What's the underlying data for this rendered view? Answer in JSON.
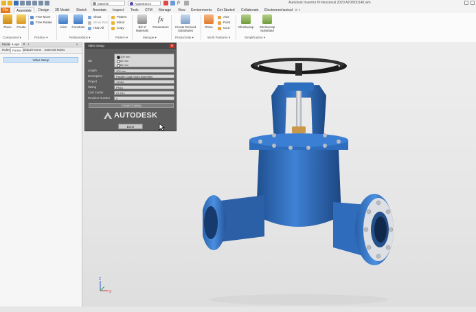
{
  "titlebar": {
    "material": "Material",
    "appearance": "Appearance",
    "app_title": "Autodesk Inventor Professional 2020   AZ08/00148.iam"
  },
  "ribbon_tabs": [
    "File",
    "Assemble",
    "Design",
    "3D Model",
    "Sketch",
    "Annotate",
    "Inspect",
    "Tools",
    "CFM",
    "Manage",
    "View",
    "Environments",
    "Get Started",
    "Collaborate",
    "Electromechanical"
  ],
  "ribbon": {
    "place": "Place",
    "create": "Create",
    "component_panel": "Component",
    "free_move": "Free Move",
    "free_rotate": "Free Rotate",
    "position_panel": "Position",
    "joint": "Joint",
    "constrain": "Constrain",
    "show": "Show",
    "show_sick": "Show Sick",
    "hide_all": "Hide All",
    "relationships_panel": "Relationships",
    "pattern": "Pattern",
    "mirror": "Mirror",
    "copy": "Copy",
    "pattern_panel": "Pattern",
    "bom_materials": "Bill of Materials",
    "parameters": "Parameters",
    "manage_panel": "Manage",
    "create_derived": "Create Derived Substitutes",
    "productivity_panel": "Productivity",
    "plane": "Plane",
    "axis": "Axis",
    "point": "Point",
    "ucs": "UCS",
    "work_features_panel": "Work Features",
    "shrinkwrap": "Shrinkwrap",
    "shrinkwrap_sub": "Shrinkwrap Substitute",
    "simplification_panel": "Simplification"
  },
  "panel": {
    "tabs": [
      "Model",
      "iLogic"
    ],
    "subtabs": [
      "Rules",
      "Forms",
      "Global Forms",
      "External Rules"
    ],
    "valve_setup": "Valve Setup"
  },
  "dialog": {
    "title": "Valve Setup",
    "size_label": "NB",
    "sizes": [
      {
        "label": "100 mm",
        "selected": true
      },
      {
        "label": "50 mm",
        "selected": false
      },
      {
        "label": "80 mm",
        "selected": false
      }
    ],
    "fields": [
      {
        "label": "Length",
        "value": "305 mm"
      },
      {
        "label": "Description",
        "value": "Parallel Cage Valve Assembly"
      },
      {
        "label": "Project",
        "value": "12050"
      },
      {
        "label": "Rating",
        "value": "PN16"
      },
      {
        "label": "Cost Center",
        "value": "01-104"
      },
      {
        "label": "Revision Number",
        "value": "0"
      }
    ],
    "create_drawing": "Create Drawing",
    "logo": "AUTODESK",
    "done": "Done"
  },
  "viewport": {
    "triad_x": "X",
    "triad_z": "Z"
  }
}
